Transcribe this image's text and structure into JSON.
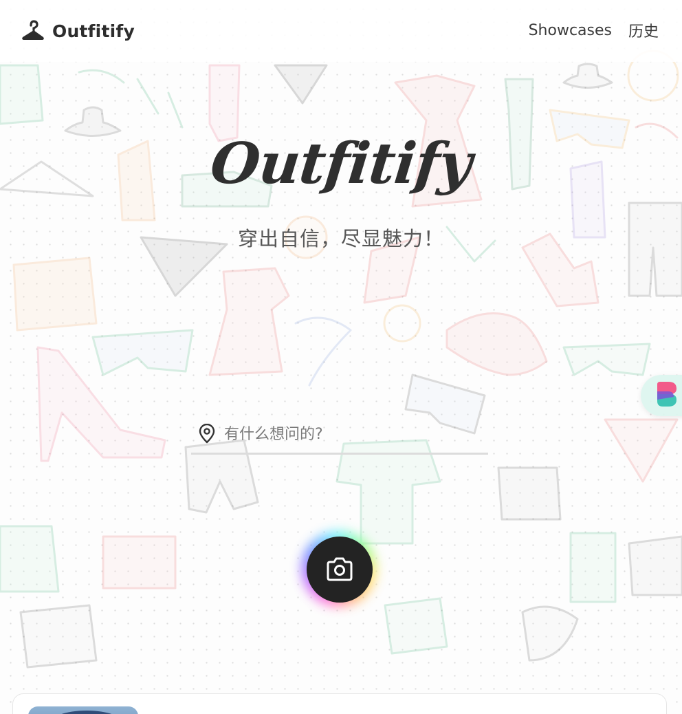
{
  "header": {
    "brand_name": "Outfitify",
    "brand_icon": "hanger-icon",
    "nav": [
      {
        "label": "Showcases"
      },
      {
        "label": "历史"
      }
    ]
  },
  "hero": {
    "title": "Outfitify",
    "subtitle": "穿出自信，尽显魅力！"
  },
  "search": {
    "icon": "map-pin-icon",
    "placeholder": "有什么想问的?",
    "value": ""
  },
  "camera_button": {
    "icon": "camera-icon"
  },
  "side_widget": {
    "icon": "app-logo-icon"
  },
  "colors": {
    "text_dark": "#2d2d2d",
    "button_dark": "#232323",
    "underline": "#dcdcdc",
    "widget_bg": "#dcf5ee"
  }
}
